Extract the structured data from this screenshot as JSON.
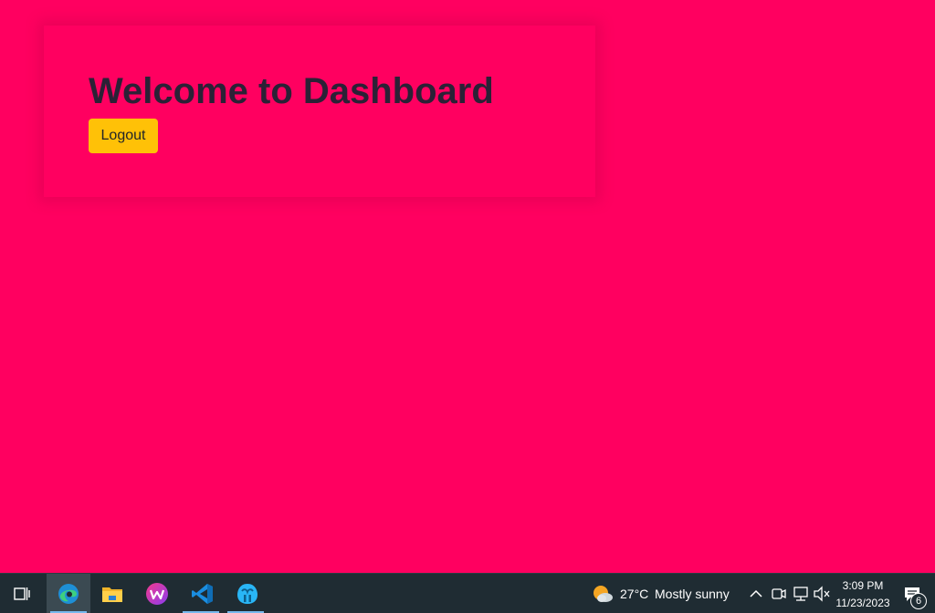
{
  "main": {
    "title": "Welcome to Dashboard",
    "logout_label": "Logout"
  },
  "taskbar": {
    "apps": [
      {
        "name": "task-view-icon"
      },
      {
        "name": "edge-icon",
        "active": true
      },
      {
        "name": "file-explorer-icon"
      },
      {
        "name": "wps-office-icon"
      },
      {
        "name": "vscode-icon"
      },
      {
        "name": "app-icon"
      }
    ],
    "weather": {
      "temperature": "27°C",
      "condition": "Mostly sunny"
    },
    "clock": {
      "time": "3:09 PM",
      "date": "11/23/2023"
    },
    "notifications_count": "6"
  },
  "colors": {
    "background": "#ff0060",
    "title": "#2b2136",
    "button": "#ffc107",
    "taskbar": "#1f2c33"
  }
}
